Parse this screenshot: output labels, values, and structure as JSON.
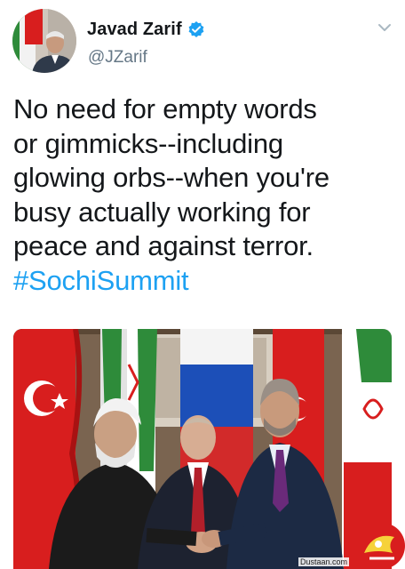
{
  "tweet": {
    "author": {
      "display_name": "Javad Zarif",
      "handle": "@JZarif",
      "verified": true,
      "avatar_icon": "profile-photo"
    },
    "menu_icon": "chevron-down-icon",
    "text_lines": [
      "No need for empty words",
      "or gimmicks--including",
      "glowing orbs--when you're",
      "busy actually working for",
      "peace and against terror."
    ],
    "hashtag": "#SochiSummit",
    "media": {
      "type": "photo",
      "flags": [
        "Turkey",
        "Iran",
        "Russia",
        "Turkey",
        "Iran"
      ]
    }
  },
  "watermark": {
    "site": "Dustaan.com",
    "logo_icon": "site-logo-watermark"
  },
  "colors": {
    "text": "#14171a",
    "secondary": "#657786",
    "link": "#1da1f2",
    "verified": "#1da1f2"
  }
}
